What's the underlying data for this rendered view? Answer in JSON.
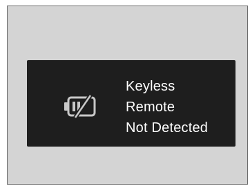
{
  "display": {
    "icon": "low-battery-icon",
    "message_lines": [
      "Keyless",
      "Remote",
      "Not Detected"
    ],
    "colors": {
      "screen_background": "#1e1e1e",
      "text": "#ffffff",
      "icon": "#c8c8c8"
    }
  }
}
